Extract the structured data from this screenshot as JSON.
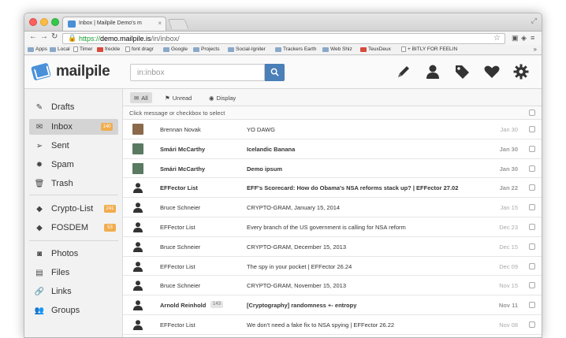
{
  "browser": {
    "tab_title": "Inbox | Mailpile Demo's m",
    "tab_close": "×",
    "url_scheme": "https://",
    "url_host": "demo.mailpile.is",
    "url_path": "/in/inbox/",
    "bookmarks": [
      "Apps",
      "Local",
      "Timer",
      "freckle",
      "font dragr",
      "Google",
      "Projects",
      "Social-Igniter",
      "Trackers Earth",
      "Web Shiz",
      "TeuxDeux",
      "+ BITLY FOR FEELIN"
    ],
    "more": "»"
  },
  "app": {
    "logo": "mailpile",
    "search_placeholder": "in:inbox"
  },
  "sidebar": {
    "items": [
      {
        "label": "Drafts",
        "icon": "pencil-icon"
      },
      {
        "label": "Inbox",
        "icon": "envelope-icon",
        "badge": "140"
      },
      {
        "label": "Sent",
        "icon": "send-icon"
      },
      {
        "label": "Spam",
        "icon": "spam-icon"
      },
      {
        "label": "Trash",
        "icon": "trash-icon"
      },
      {
        "label": "Crypto-List",
        "icon": "tag-icon",
        "badge": "241"
      },
      {
        "label": "FOSDEM",
        "icon": "tag-icon",
        "badge": "53"
      },
      {
        "label": "Photos",
        "icon": "camera-icon"
      },
      {
        "label": "Files",
        "icon": "file-icon"
      },
      {
        "label": "Links",
        "icon": "link-icon"
      },
      {
        "label": "Groups",
        "icon": "group-icon"
      }
    ]
  },
  "filters": {
    "all": "All",
    "unread": "Unread",
    "display": "Display"
  },
  "instruction": "Click message or checkbox to select",
  "messages": [
    {
      "from": "Brennan Novak",
      "subject": "YO DAWG",
      "date": "Jan 30",
      "unread": false,
      "avatar": "photo"
    },
    {
      "from": "Smári McCarthy",
      "subject": "Icelandic Banana",
      "date": "Jan 30",
      "unread": true,
      "avatar": "photo"
    },
    {
      "from": "Smári McCarthy",
      "subject": "Demo ipsum",
      "date": "Jan 30",
      "unread": true,
      "avatar": "photo"
    },
    {
      "from": "EFFector List",
      "subject": "EFF's Scorecard: How do Obama's NSA reforms stack up? | EFFector 27.02",
      "date": "Jan 22",
      "unread": true,
      "avatar": "person"
    },
    {
      "from": "Bruce Schneier",
      "subject": "CRYPTO-GRAM, January 15, 2014",
      "date": "Jan 15",
      "unread": false,
      "avatar": "person"
    },
    {
      "from": "EFFector List",
      "subject": "Every branch of the US government is calling for NSA reform",
      "date": "Dec 23",
      "unread": false,
      "avatar": "person"
    },
    {
      "from": "Bruce Schneier",
      "subject": "CRYPTO-GRAM, December 15, 2013",
      "date": "Dec 15",
      "unread": false,
      "avatar": "person"
    },
    {
      "from": "EFFector List",
      "subject": "The spy in your pocket | EFFector 26.24",
      "date": "Dec 09",
      "unread": false,
      "avatar": "person"
    },
    {
      "from": "Bruce Schneier",
      "subject": "CRYPTO-GRAM, November 15, 2013",
      "date": "Nov 15",
      "unread": false,
      "avatar": "person"
    },
    {
      "from": "Arnold Reinhold",
      "count": "143",
      "subject": "[Cryptography] randomness +- entropy",
      "date": "Nov 11",
      "unread": true,
      "avatar": "person"
    },
    {
      "from": "EFFector List",
      "subject": "We don't need a fake fix to NSA spying | EFFector 26.22",
      "date": "Nov 08",
      "unread": false,
      "avatar": "person"
    }
  ]
}
